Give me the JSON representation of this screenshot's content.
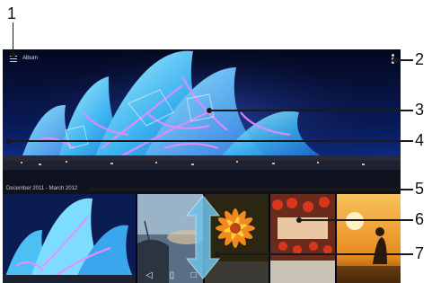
{
  "header": {
    "album_title": "Album"
  },
  "date_range": "December 2011 - March 2012",
  "callouts": [
    "1",
    "2",
    "3",
    "4",
    "5",
    "6",
    "7"
  ],
  "icons": {
    "menu": "menu-icon",
    "overflow": "overflow-menu-icon",
    "scroll_arrows": "up-down-arrow-icon",
    "nav_back": "back-icon",
    "nav_home": "home-icon",
    "nav_recent": "recent-apps-icon"
  },
  "nav_glyphs": {
    "back": "◁",
    "home": "▯",
    "recent": "□"
  },
  "colors": {
    "accent_arrow": "#6fc2ea",
    "screen_bg": "#06081a"
  }
}
